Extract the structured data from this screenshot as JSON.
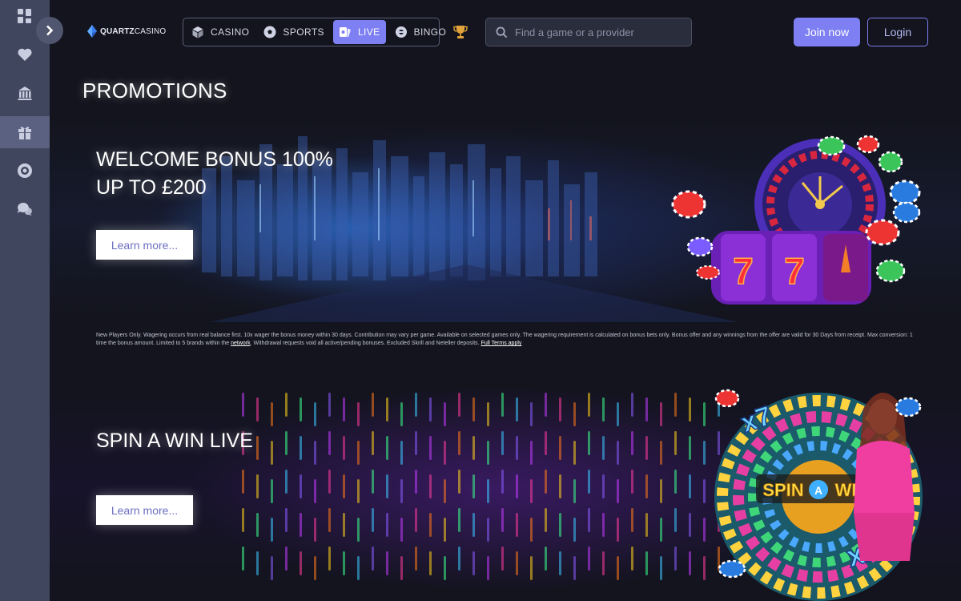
{
  "brand": {
    "logo_text_bold": "QUARTZ",
    "logo_text": "CASINO"
  },
  "nav": {
    "tabs": [
      {
        "label": "CASINO",
        "icon": "dice-icon",
        "active": false
      },
      {
        "label": "SPORTS",
        "icon": "soccer-ball-icon",
        "active": false
      },
      {
        "label": "LIVE",
        "icon": "live-cards-icon",
        "active": true
      },
      {
        "label": "BINGO",
        "icon": "bingo-ball-icon",
        "active": false
      }
    ]
  },
  "search": {
    "placeholder": "Find a game or a provider",
    "value": ""
  },
  "auth": {
    "join_label": "Join now",
    "login_label": "Login"
  },
  "sidebar": {
    "items": [
      {
        "icon": "grid-icon",
        "active": false
      },
      {
        "icon": "heart-icon",
        "active": false
      },
      {
        "icon": "building-icon",
        "active": false
      },
      {
        "icon": "gift-icon",
        "active": true
      },
      {
        "icon": "lifebuoy-icon",
        "active": false
      },
      {
        "icon": "chat-icon",
        "active": false
      }
    ]
  },
  "page": {
    "title": "PROMOTIONS"
  },
  "promotions": [
    {
      "title": "WELCOME BONUS 100% UP TO £200",
      "button_label": "Learn more...",
      "terms_text": "New Players Only. Wagering occurs from real balance first. 10x wager the bonus money within 30 days. Contribution may vary per game. Available on selected games only. The wagering requirement is calculated on bonus bets only. Bonus offer and any winnings from the offer are valid for 30 Days from receipt. Max conversion: 1 time the bonus amount. Limited to 5 brands within the ",
      "terms_link_network": "network",
      "terms_text_2": ". Withdrawal requests void all active/pending bonuses. Excluded Skrill and Neteller deposits. ",
      "terms_link_full": "Full Terms apply",
      "art_reel_text": "7"
    },
    {
      "title": "SPIN A WIN LIVE",
      "button_label": "Learn more...",
      "art_logo_left": "SPIN",
      "art_logo_mid": "A",
      "art_logo_right": "WIN",
      "art_mult_1": "x7",
      "art_mult_2": "x2"
    }
  ],
  "colors": {
    "accent": "#7d7ff2",
    "background": "#13141d",
    "sidebar": "#41465f"
  }
}
